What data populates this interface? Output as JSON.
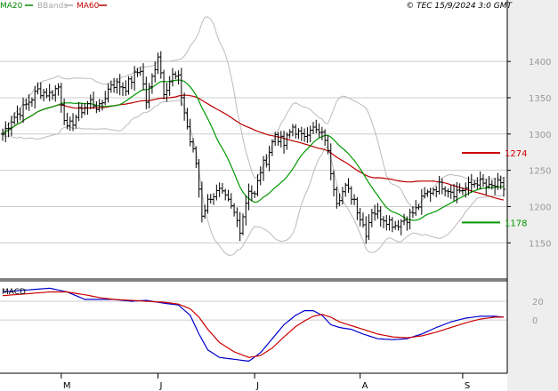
{
  "header": {
    "legend": [
      {
        "label": "MA20",
        "color": "#008800"
      },
      {
        "label": "BBands",
        "color": "#aaaaaa"
      },
      {
        "label": "MA60",
        "color": "#bb0000"
      }
    ],
    "copyright": "© TEC 15/9/2024 3:0 GMT"
  },
  "colors": {
    "price": "#000000",
    "ma20": "#009900",
    "ma60": "#bb0000",
    "bbands": "#bbbbbb",
    "macd": "#0000cc",
    "signal": "#cc0000",
    "grid": "#cccccc",
    "background": "#ffffff",
    "panel_right": "#eeeeee"
  },
  "chart_data": [
    {
      "type": "ohlc",
      "title": "",
      "ylim": [
        1105,
        1470
      ],
      "y_ticks": [
        {
          "value": 1150,
          "label": "1150"
        },
        {
          "value": 1200,
          "label": "1200"
        },
        {
          "value": 1250,
          "label": "1250"
        },
        {
          "value": 1300,
          "label": "1300"
        },
        {
          "value": 1350,
          "label": "1350"
        },
        {
          "value": 1400,
          "label": "1400"
        }
      ],
      "x_ticks": [
        {
          "index": 20,
          "label": "M"
        },
        {
          "index": 53,
          "label": "J"
        },
        {
          "index": 86,
          "label": "J"
        },
        {
          "index": 122,
          "label": "A"
        },
        {
          "index": 157,
          "label": "S"
        }
      ],
      "bar_count": 172,
      "levels": [
        {
          "name": "resistance",
          "value": 1274,
          "label": "1274",
          "color": "#cc0000"
        },
        {
          "name": "support",
          "value": 1178,
          "label": "1178",
          "color": "#009900"
        }
      ],
      "anchors": [
        [
          0,
          1300
        ],
        [
          3,
          1320
        ],
        [
          7,
          1335
        ],
        [
          12,
          1360
        ],
        [
          16,
          1355
        ],
        [
          19,
          1365
        ],
        [
          22,
          1305
        ],
        [
          26,
          1330
        ],
        [
          30,
          1345
        ],
        [
          33,
          1335
        ],
        [
          37,
          1370
        ],
        [
          42,
          1365
        ],
        [
          47,
          1390
        ],
        [
          49,
          1345
        ],
        [
          53,
          1410
        ],
        [
          55,
          1360
        ],
        [
          58,
          1380
        ],
        [
          60,
          1375
        ],
        [
          62,
          1330
        ],
        [
          64,
          1290
        ],
        [
          66,
          1260
        ],
        [
          68,
          1190
        ],
        [
          71,
          1215
        ],
        [
          74,
          1220
        ],
        [
          77,
          1205
        ],
        [
          79,
          1190
        ],
        [
          81,
          1170
        ],
        [
          84,
          1225
        ],
        [
          86,
          1215
        ],
        [
          88,
          1250
        ],
        [
          90,
          1265
        ],
        [
          93,
          1300
        ],
        [
          96,
          1285
        ],
        [
          99,
          1310
        ],
        [
          102,
          1295
        ],
        [
          105,
          1310
        ],
        [
          108,
          1300
        ],
        [
          110,
          1295
        ],
        [
          112,
          1250
        ],
        [
          114,
          1210
        ],
        [
          117,
          1225
        ],
        [
          120,
          1210
        ],
        [
          122,
          1185
        ],
        [
          124,
          1165
        ],
        [
          126,
          1195
        ],
        [
          130,
          1185
        ],
        [
          134,
          1175
        ],
        [
          138,
          1185
        ],
        [
          141,
          1195
        ],
        [
          144,
          1215
        ],
        [
          147,
          1225
        ],
        [
          150,
          1230
        ],
        [
          154,
          1220
        ],
        [
          158,
          1225
        ],
        [
          162,
          1235
        ],
        [
          166,
          1225
        ],
        [
          169,
          1230
        ],
        [
          171,
          1225
        ]
      ]
    },
    {
      "type": "line",
      "title": "",
      "series_label": "MACD",
      "ylim": [
        -55,
        40
      ],
      "y_ticks": [
        {
          "value": 20,
          "label": "20"
        },
        {
          "value": 0,
          "label": "0"
        }
      ],
      "macd_anchors": [
        [
          0,
          30
        ],
        [
          8,
          32
        ],
        [
          16,
          34
        ],
        [
          22,
          30
        ],
        [
          28,
          22
        ],
        [
          33,
          22
        ],
        [
          38,
          22
        ],
        [
          44,
          20
        ],
        [
          49,
          21
        ],
        [
          55,
          18
        ],
        [
          60,
          16
        ],
        [
          64,
          5
        ],
        [
          67,
          -15
        ],
        [
          70,
          -32
        ],
        [
          74,
          -40
        ],
        [
          79,
          -42
        ],
        [
          84,
          -44
        ],
        [
          88,
          -35
        ],
        [
          92,
          -20
        ],
        [
          96,
          -5
        ],
        [
          100,
          5
        ],
        [
          103,
          10
        ],
        [
          106,
          10
        ],
        [
          109,
          5
        ],
        [
          112,
          -5
        ],
        [
          115,
          -8
        ],
        [
          119,
          -10
        ],
        [
          123,
          -15
        ],
        [
          128,
          -20
        ],
        [
          133,
          -21
        ],
        [
          138,
          -20
        ],
        [
          143,
          -15
        ],
        [
          148,
          -8
        ],
        [
          153,
          -2
        ],
        [
          158,
          2
        ],
        [
          163,
          4
        ],
        [
          168,
          4
        ],
        [
          171,
          3
        ]
      ],
      "signal_anchors": [
        [
          0,
          26
        ],
        [
          8,
          28
        ],
        [
          16,
          30
        ],
        [
          22,
          30
        ],
        [
          28,
          27
        ],
        [
          33,
          24
        ],
        [
          38,
          22
        ],
        [
          44,
          21
        ],
        [
          49,
          20
        ],
        [
          55,
          19
        ],
        [
          60,
          17
        ],
        [
          64,
          12
        ],
        [
          67,
          3
        ],
        [
          70,
          -10
        ],
        [
          74,
          -24
        ],
        [
          79,
          -34
        ],
        [
          84,
          -40
        ],
        [
          88,
          -38
        ],
        [
          92,
          -30
        ],
        [
          96,
          -18
        ],
        [
          100,
          -7
        ],
        [
          103,
          -1
        ],
        [
          106,
          4
        ],
        [
          109,
          6
        ],
        [
          112,
          3
        ],
        [
          115,
          -2
        ],
        [
          119,
          -6
        ],
        [
          123,
          -10
        ],
        [
          128,
          -15
        ],
        [
          133,
          -18
        ],
        [
          138,
          -19
        ],
        [
          143,
          -17
        ],
        [
          148,
          -13
        ],
        [
          153,
          -8
        ],
        [
          158,
          -3
        ],
        [
          163,
          1
        ],
        [
          168,
          3
        ],
        [
          171,
          3
        ]
      ]
    }
  ]
}
